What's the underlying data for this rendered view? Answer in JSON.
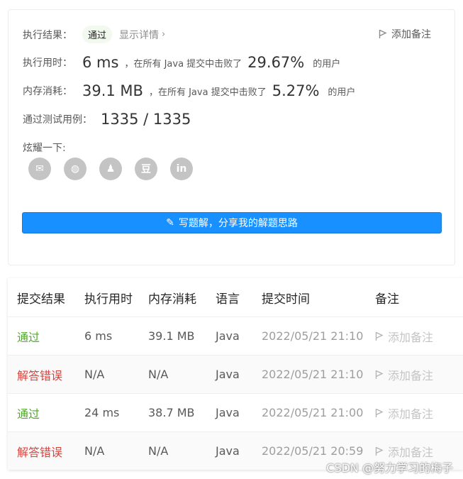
{
  "result_card": {
    "result_label": "执行结果：",
    "result_value": "通过",
    "detail_link": "显示详情",
    "add_note": "添加备注",
    "time_label": "执行用时：",
    "time_value": "6 ms",
    "time_mid": "，在所有 Java 提交中击败了",
    "time_percent": "29.67%",
    "time_suffix": "的用户",
    "mem_label": "内存消耗：",
    "mem_value": "39.1 MB",
    "mem_mid": "，在所有 Java 提交中击败了",
    "mem_percent": "5.27%",
    "mem_suffix": "的用户",
    "cases_label": "通过测试用例：",
    "cases_value": "1335 / 1335",
    "share_label": "炫耀一下:",
    "share_icons": [
      "wechat-icon",
      "weibo-icon",
      "qq-icon",
      "douban-icon",
      "linkedin-icon"
    ],
    "share_glyphs": {
      "wechat": "✉",
      "weibo": "◍",
      "qq": "♟",
      "douban": "豆",
      "linkedin": "in"
    },
    "solution_button": "写题解，分享我的解题思路"
  },
  "table": {
    "headers": [
      "提交结果",
      "执行用时",
      "内存消耗",
      "语言",
      "提交时间",
      "备注"
    ],
    "rows": [
      {
        "result": "通过",
        "status": "pass",
        "time": "6 ms",
        "memory": "39.1 MB",
        "lang": "Java",
        "submitted": "2022/05/21 21:10",
        "note": "添加备注"
      },
      {
        "result": "解答错误",
        "status": "wrong",
        "time": "N/A",
        "memory": "N/A",
        "lang": "Java",
        "submitted": "2022/05/21 21:10",
        "note": "添加备注"
      },
      {
        "result": "通过",
        "status": "pass",
        "time": "24 ms",
        "memory": "38.7 MB",
        "lang": "Java",
        "submitted": "2022/05/21 21:00",
        "note": "添加备注"
      },
      {
        "result": "解答错误",
        "status": "wrong",
        "time": "N/A",
        "memory": "N/A",
        "lang": "Java",
        "submitted": "2022/05/21 20:59",
        "note": "添加备注"
      }
    ]
  },
  "colors": {
    "accent": "#1890ff",
    "pass": "#52a82f",
    "wrong": "#e0413a"
  },
  "watermark": "CSDN @努力学习的梅子"
}
